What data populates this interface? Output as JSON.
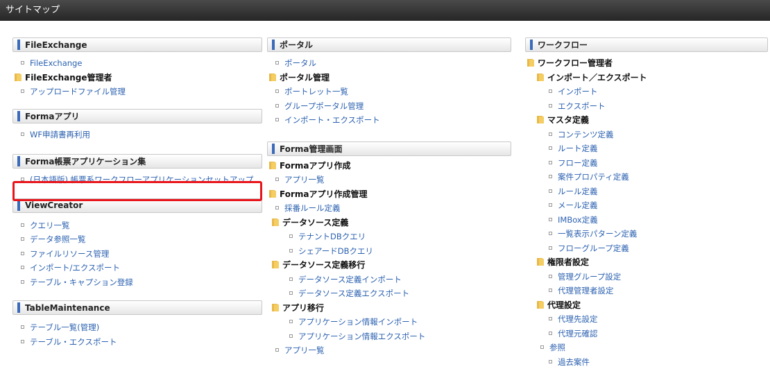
{
  "title": "サイトマップ",
  "col1": {
    "fileexchange": {
      "header": "FileExchange",
      "items": [
        "FileExchange",
        "FileExchange管理者",
        "アップロードファイル管理"
      ]
    },
    "forma_app": {
      "header": "Formaアプリ",
      "items": [
        "WF申請書再利用"
      ]
    },
    "forma_form": {
      "header": "Forma帳票アプリケーション集",
      "items": [
        "(日本語版) 帳票系ワークフローアプリケーションセットアップ"
      ]
    },
    "viewcreator": {
      "header": "ViewCreator",
      "items": [
        "クエリ一覧",
        "データ参照一覧",
        "ファイルリソース管理",
        "インポート/エクスポート",
        "テーブル・キャプション登録"
      ]
    },
    "tablemaintenance": {
      "header": "TableMaintenance",
      "items": [
        "テーブル一覧(管理)",
        "テーブル・エクスポート"
      ]
    }
  },
  "col2": {
    "portal": {
      "header": "ポータル",
      "items": [
        "ポータル",
        "ポータル管理",
        "ポートレット一覧",
        "グループポータル管理",
        "インポート・エクスポート"
      ]
    },
    "forma_admin": {
      "header": "Forma管理画面",
      "items": [
        "Formaアプリ作成",
        "アプリ一覧",
        "Formaアプリ作成管理",
        "採番ルール定義",
        "データソース定義",
        "テナントDBクエリ",
        "シェアードDBクエリ",
        "データソース定義移行",
        "データソース定義インポート",
        "データソース定義エクスポート",
        "アプリ移行",
        "アプリケーション情報インポート",
        "アプリケーション情報エクスポート",
        "アプリ一覧"
      ]
    }
  },
  "col3": {
    "workflow": {
      "header": "ワークフロー",
      "items": [
        "ワークフロー管理者",
        "インポート／エクスポート",
        "インポート",
        "エクスポート",
        "マスタ定義",
        "コンテンツ定義",
        "ルート定義",
        "フロー定義",
        "案件プロパティ定義",
        "ルール定義",
        "メール定義",
        "IMBox定義",
        "一覧表示パターン定義",
        "フローグループ定義",
        "権限者設定",
        "管理グループ設定",
        "代理管理者設定",
        "代理設定",
        "代理先設定",
        "代理元確認",
        "参照",
        "過去案件"
      ]
    }
  },
  "colors": {
    "link": "#2b61b0",
    "highlight": "#e8141a",
    "header_bar": "#3a6ab8",
    "folder": "#e8b94a"
  }
}
